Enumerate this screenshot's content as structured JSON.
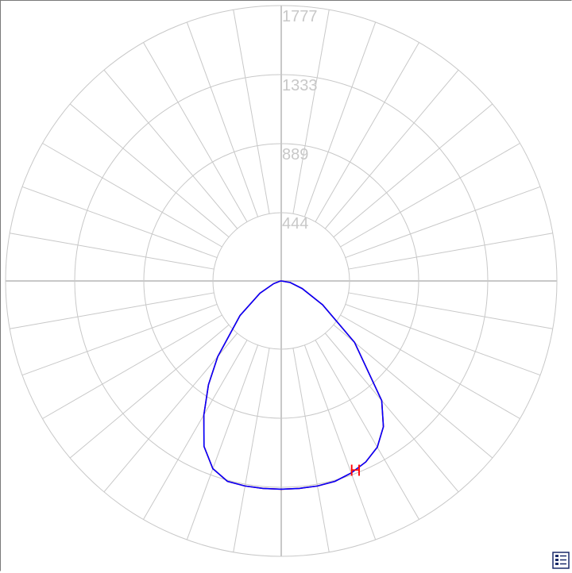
{
  "chart_data": {
    "type": "polar",
    "radial_ticks": [
      "444",
      "889",
      "1333",
      "1777"
    ],
    "radial_tick_values": [
      444,
      889,
      1333,
      1777
    ],
    "radial_max": 1777,
    "angular_step_deg": 10,
    "grid": true,
    "angle_units": "degrees, 0 = straight down (nadir), measured toward horizontal",
    "series": [
      {
        "name": "H",
        "color": "#ff0000",
        "label_angle": 20,
        "points": [
          [
            -90,
            0
          ],
          [
            -80,
            8
          ],
          [
            -70,
            52
          ],
          [
            -60,
            160
          ],
          [
            -50,
            350
          ],
          [
            -40,
            640
          ],
          [
            -35,
            820
          ],
          [
            -30,
            1000
          ],
          [
            -25,
            1180
          ],
          [
            -20,
            1290
          ],
          [
            -15,
            1340
          ],
          [
            -10,
            1345
          ],
          [
            -5,
            1345
          ],
          [
            0,
            1345
          ],
          [
            5,
            1345
          ],
          [
            10,
            1345
          ],
          [
            15,
            1340
          ],
          [
            20,
            1320
          ],
          [
            25,
            1290
          ],
          [
            30,
            1240
          ],
          [
            35,
            1150
          ],
          [
            40,
            1010
          ],
          [
            50,
            620
          ],
          [
            60,
            310
          ],
          [
            70,
            145
          ],
          [
            80,
            60
          ],
          [
            90,
            0
          ]
        ]
      },
      {
        "name": "",
        "color": "#0000ff",
        "points": [
          [
            -90,
            0
          ],
          [
            -80,
            8
          ],
          [
            -70,
            52
          ],
          [
            -60,
            160
          ],
          [
            -50,
            350
          ],
          [
            -40,
            640
          ],
          [
            -35,
            820
          ],
          [
            -30,
            1000
          ],
          [
            -25,
            1180
          ],
          [
            -20,
            1290
          ],
          [
            -15,
            1340
          ],
          [
            -10,
            1345
          ],
          [
            -5,
            1345
          ],
          [
            0,
            1345
          ],
          [
            5,
            1345
          ],
          [
            10,
            1345
          ],
          [
            15,
            1340
          ],
          [
            20,
            1320
          ],
          [
            25,
            1290
          ],
          [
            30,
            1240
          ],
          [
            35,
            1150
          ],
          [
            40,
            1010
          ],
          [
            50,
            620
          ],
          [
            60,
            310
          ],
          [
            70,
            145
          ],
          [
            80,
            60
          ],
          [
            90,
            0
          ]
        ]
      }
    ]
  },
  "toolbar": {
    "corner_icon": "document-list-icon"
  }
}
